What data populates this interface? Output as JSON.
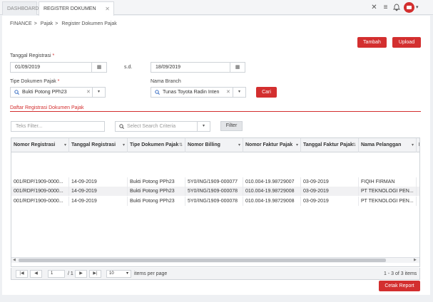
{
  "tabs": [
    {
      "label": "DASHBOARD"
    },
    {
      "label": "REGISTER DOKUMEN PAJAK",
      "close": "✕"
    }
  ],
  "topbar": {
    "icons": [
      "expand-icon",
      "menu-icon",
      "bell-icon",
      "user-avatar"
    ],
    "caret": "▾"
  },
  "breadcrumb": {
    "items": [
      "FINANCE",
      "Pajak",
      "Register Dokumen Pajak"
    ],
    "separator": ">"
  },
  "actions": {
    "add_label": "Tambah",
    "upload_label": "Upload"
  },
  "form": {
    "tanggal_label": "Tanggal Registrasi",
    "required_mark": "*",
    "date_from": "01/09/2019",
    "sd_label": "s.d.",
    "date_to": "18/09/2019",
    "tipe_label": "Tipe Dokumen Pajak",
    "tipe_value": "Bukti Potong PPh23",
    "branch_label": "Nama Branch",
    "branch_value": "Tunas Toyota Radin Inten",
    "search_label": "Cari"
  },
  "section_title": "Daftar Registrasi Dokumen Pajak",
  "filter": {
    "text_placeholder": "Teks Filter...",
    "criteria_placeholder": "Select Search Criteria",
    "filter_label": "Filter"
  },
  "table": {
    "columns": [
      "Nomor Registrasi",
      "Tanggal Registrasi",
      "Tipe Dokumen Pajak",
      "Nomor Billing",
      "Nomor Faktur Pajak",
      "Tanggal Faktur Pajak",
      "Nama Pelanggan",
      "N"
    ],
    "rows": [
      [
        "001/RDP/1909-0000...",
        "14-09-2019",
        "Bukti Potong PPh23",
        "5Y0/ING/1909-000077",
        "010.004-19.98729007",
        "03-09-2019",
        "FIQIH FIRMAN"
      ],
      [
        "001/RDP/1909-0000...",
        "14-09-2019",
        "Bukti Potong PPh23",
        "5Y0/ING/1909-000078",
        "010.004-19.98729008",
        "03-09-2019",
        "PT TEKNOLOGI PEN..."
      ],
      [
        "001/RDP/1909-0000...",
        "14-09-2019",
        "Bukti Potong PPh23",
        "5Y0/ING/1909-000078",
        "010.004-19.98729008",
        "03-09-2019",
        "PT TEKNOLOGI PEN..."
      ]
    ]
  },
  "pager": {
    "page": "1",
    "of_text": "/ 1",
    "page_size": "10",
    "items_label": "items per page",
    "summary": "1 - 3 of 3 items"
  },
  "report": {
    "label": "Cetak Report"
  },
  "colors": {
    "accent": "#d32f2f",
    "link": "#3a6fc4"
  }
}
